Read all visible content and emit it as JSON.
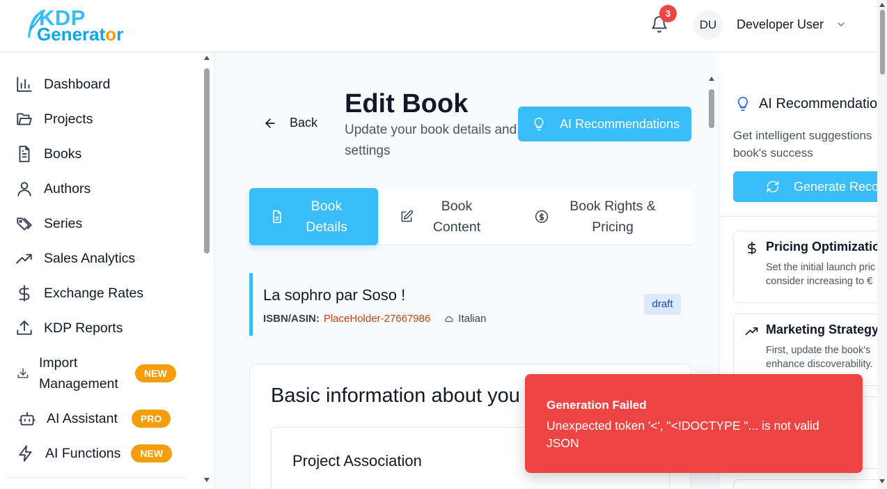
{
  "header": {
    "logo_top": "KDP",
    "logo_bottom_a": "Generat",
    "logo_bottom_b": "o",
    "logo_bottom_c": "r",
    "notification_count": "3",
    "user_initials": "DU",
    "user_name": "Developer User"
  },
  "sidebar": {
    "items": [
      {
        "label": "Dashboard",
        "icon": "bar-chart-icon"
      },
      {
        "label": "Projects",
        "icon": "folder-icon"
      },
      {
        "label": "Books",
        "icon": "document-icon"
      },
      {
        "label": "Authors",
        "icon": "user-icon"
      },
      {
        "label": "Series",
        "icon": "tags-icon"
      },
      {
        "label": "Sales Analytics",
        "icon": "trending-up-icon"
      },
      {
        "label": "Exchange Rates",
        "icon": "dollar-icon"
      },
      {
        "label": "KDP Reports",
        "icon": "upload-icon"
      },
      {
        "label": "Import\nManagement",
        "line1": "Import",
        "line2": "Management",
        "icon": "download-icon",
        "badge": "NEW"
      },
      {
        "label": "AI Assistant",
        "icon": "robot-icon",
        "badge": "PRO"
      },
      {
        "label": "AI Functions",
        "icon": "lightning-icon",
        "badge": "NEW"
      }
    ]
  },
  "main": {
    "back_label": "Back",
    "title": "Edit Book",
    "subtitle": "Update your book details and settings",
    "ai_button_label": "AI Recommendations",
    "tabs": [
      {
        "line1": "Book",
        "line2": "Details",
        "active": true
      },
      {
        "line1": "Book",
        "line2": "Content",
        "active": false
      },
      {
        "line1": "Book Rights &",
        "line2": "Pricing",
        "active": false
      }
    ],
    "book": {
      "name": "La sophro par Soso !",
      "isbn_label": "ISBN/ASIN:",
      "isbn_value": "PlaceHolder-27667986",
      "language": "Italian",
      "status": "draft"
    },
    "section_title": "Basic information about you",
    "project_association_title": "Project Association"
  },
  "right_panel": {
    "title": "AI Recommendatio",
    "description": "Get intelligent suggestions book's success",
    "generate_label": "Generate Reco",
    "recommendations": [
      {
        "title": "Pricing Optimization",
        "text": "Set the initial launch pric consider increasing to €",
        "icon": "dollar-icon"
      },
      {
        "title": "Marketing Strategy",
        "text": "First, update the book's enhance discoverability.",
        "icon": "trending-up-icon"
      }
    ]
  },
  "toast": {
    "title": "Generation Failed",
    "message": "Unexpected token '<', \"<!DOCTYPE \"... is not valid JSON"
  },
  "colors": {
    "accent": "#38bdf8",
    "toast": "#ef4444",
    "badge_orange": "#f59e0b",
    "isbn": "#c2410c"
  }
}
